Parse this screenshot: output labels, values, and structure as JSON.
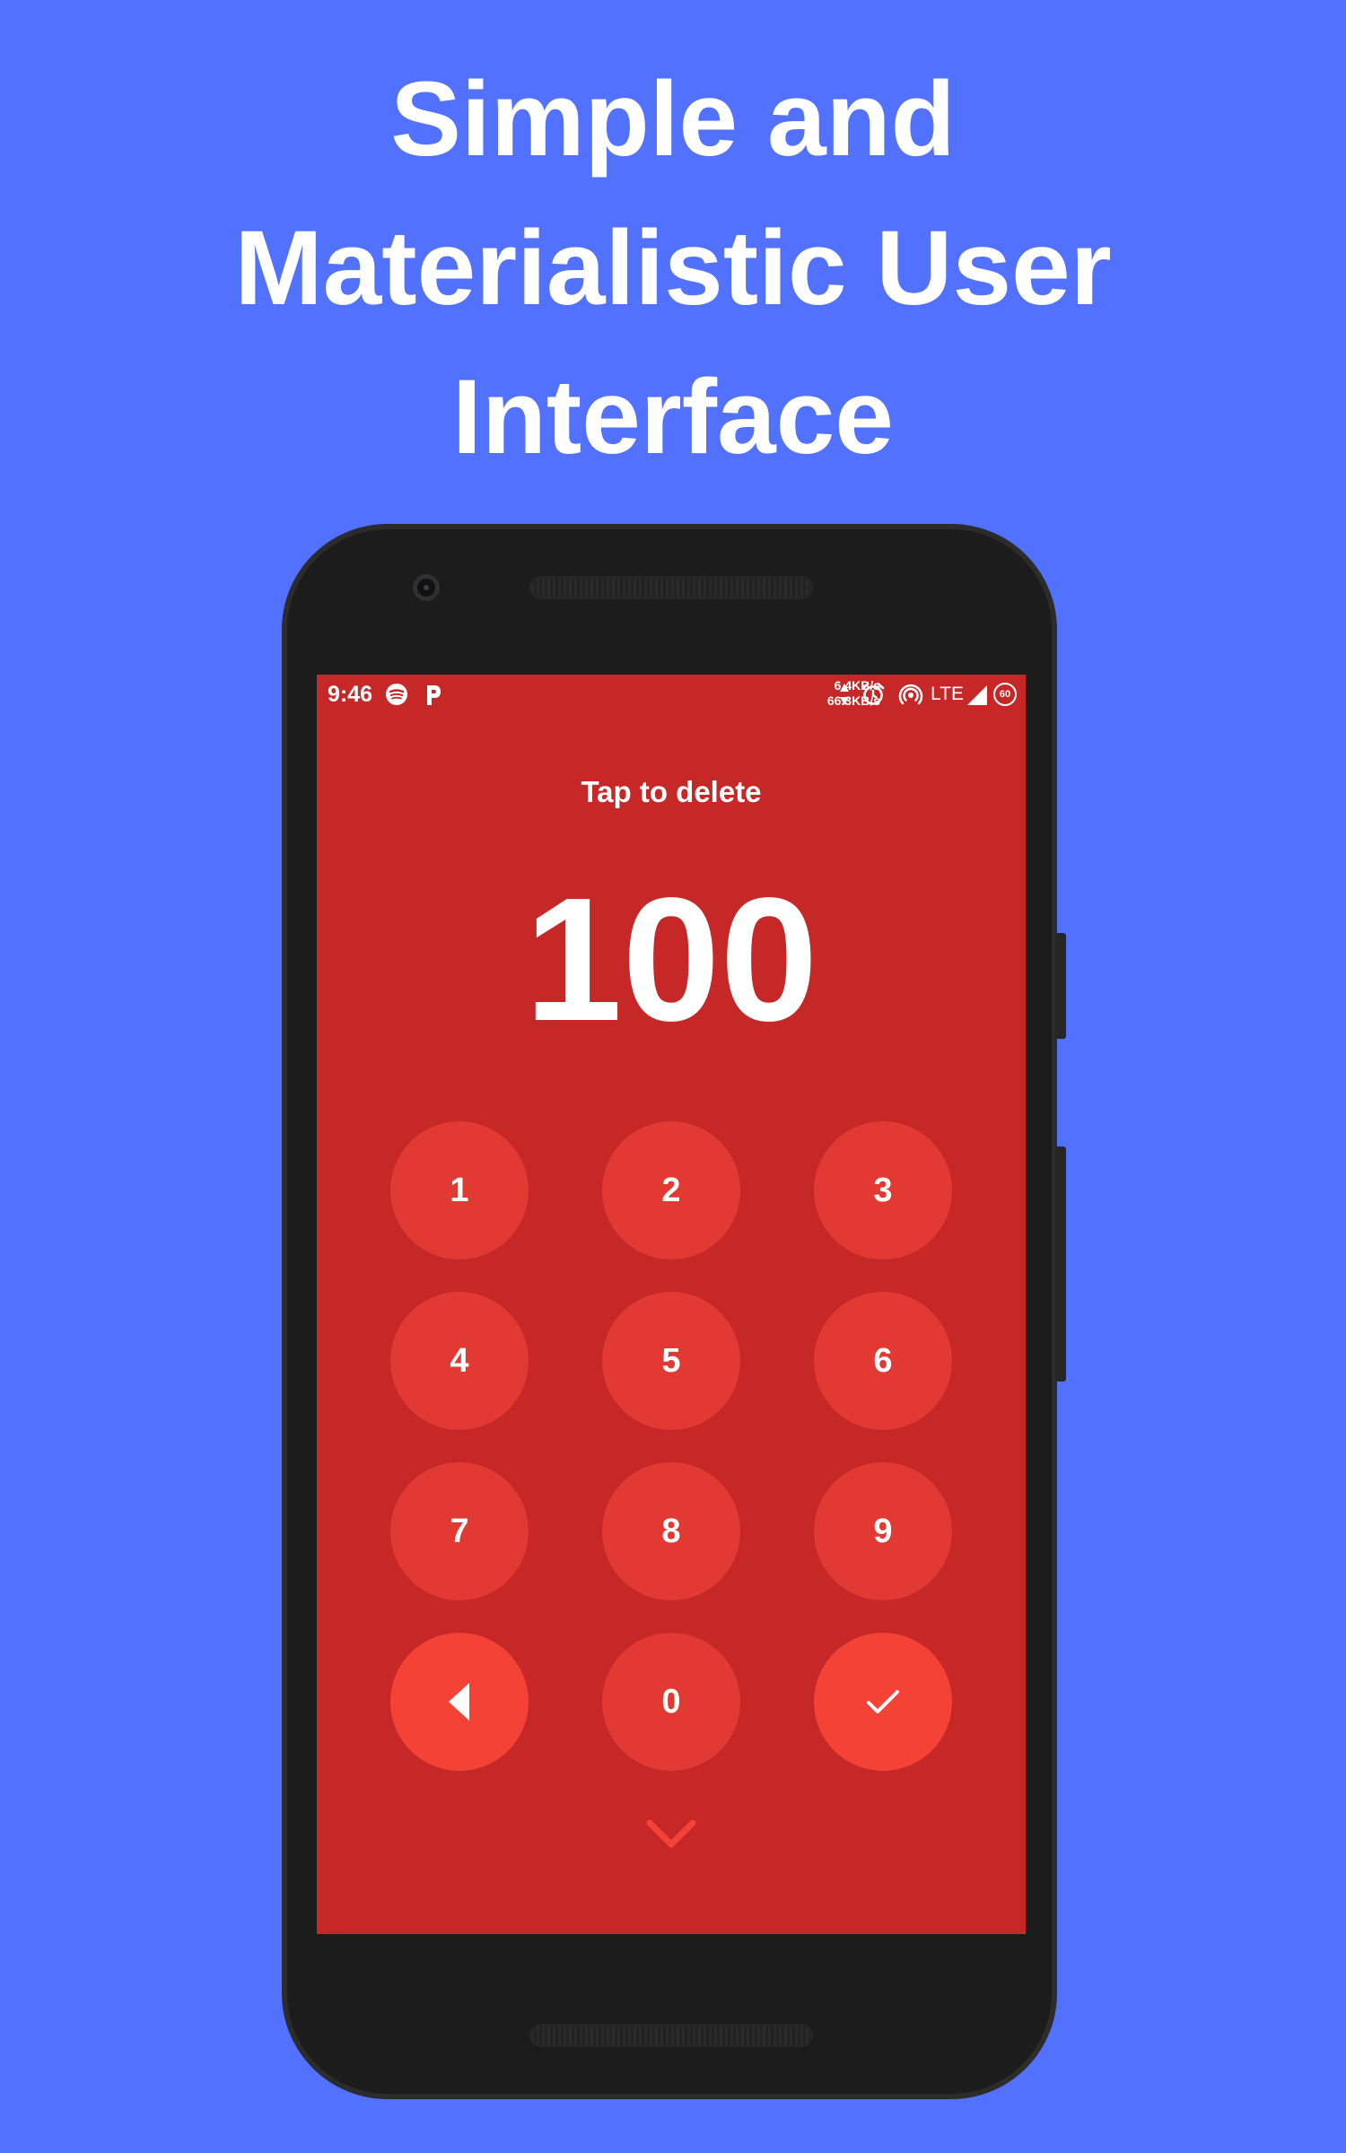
{
  "headline": {
    "line1": "Simple and",
    "line2": "Materialistic User",
    "line3": "Interface"
  },
  "status_bar": {
    "time": "9:46",
    "upload_speed": "6.4KB/s",
    "download_speed": "66.3KB/s",
    "network": "LTE",
    "battery": "60",
    "icons": [
      "spotify-icon",
      "p-app-icon",
      "data-arrows-icon",
      "alarm-icon",
      "hotspot-icon",
      "signal-icon",
      "battery-icon"
    ]
  },
  "screen": {
    "hint": "Tap to delete",
    "amount": "100"
  },
  "keypad": {
    "k1": "1",
    "k2": "2",
    "k3": "3",
    "k4": "4",
    "k5": "5",
    "k6": "6",
    "k7": "7",
    "k8": "8",
    "k9": "9",
    "k0": "0",
    "back_icon": "back-triangle-icon",
    "confirm_icon": "check-icon"
  },
  "colors": {
    "background": "#5271ff",
    "screen": "#c62828",
    "key": "#e23a32",
    "action_key": "#f44336",
    "text": "#ffffff"
  }
}
